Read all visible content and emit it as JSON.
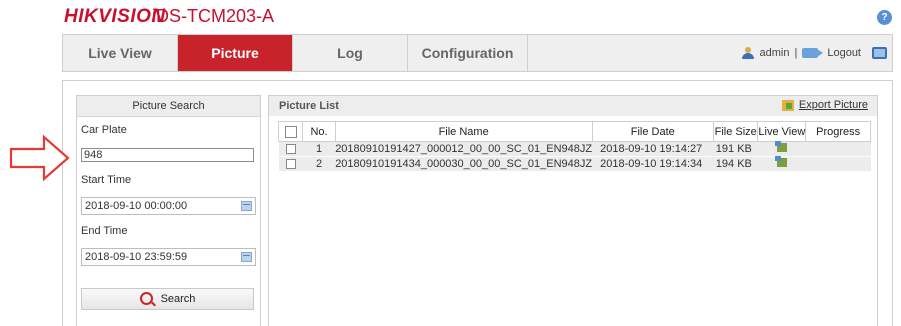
{
  "header": {
    "brand": "HIKVISION",
    "model": "iDS-TCM203-A",
    "help_label": "?"
  },
  "nav": {
    "tabs": [
      {
        "label": "Live View",
        "active": false
      },
      {
        "label": "Picture",
        "active": true
      },
      {
        "label": "Log",
        "active": false
      },
      {
        "label": "Configuration",
        "active": false
      }
    ],
    "user": "admin",
    "separator": "|",
    "logout": "Logout"
  },
  "search": {
    "title": "Picture Search",
    "car_plate_label": "Car Plate",
    "car_plate_value": "948",
    "start_time_label": "Start Time",
    "start_time_value": "2018-09-10 00:00:00",
    "end_time_label": "End Time",
    "end_time_value": "2018-09-10 23:59:59",
    "search_button": "Search"
  },
  "list": {
    "title": "Picture List",
    "export_label": "Export Picture",
    "columns": [
      "No.",
      "File Name",
      "File Date",
      "File Size",
      "Live View",
      "Progress"
    ],
    "rows": [
      {
        "no": "1",
        "file_name": "20180910191427_000012_00_00_SC_01_EN948JZ",
        "file_date": "2018-09-10 19:14:27",
        "file_size": "191 KB",
        "progress": ""
      },
      {
        "no": "2",
        "file_name": "20180910191434_000030_00_00_SC_01_EN948JZ",
        "file_date": "2018-09-10 19:14:34",
        "file_size": "194 KB",
        "progress": ""
      }
    ]
  },
  "colors": {
    "brand_red": "#c8102e",
    "active_tab": "#c8232a",
    "annotation_arrow": "#e53935"
  }
}
